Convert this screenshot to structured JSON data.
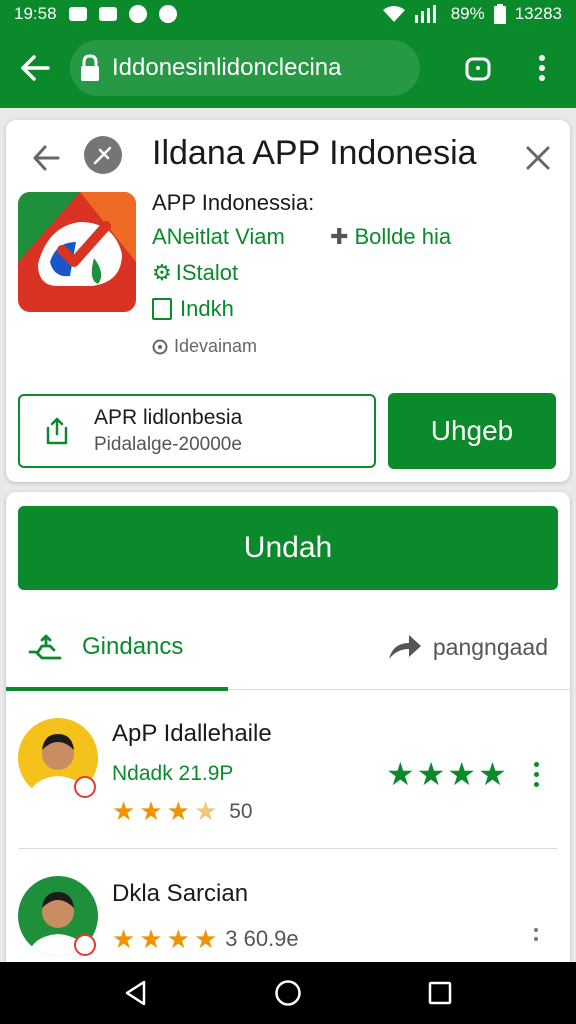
{
  "status_bar": {
    "time": "19:58",
    "battery": "89%",
    "right_time": "13283",
    "icons": [
      "mail-icon",
      "image-icon",
      "location-icon",
      "smiley-icon",
      "wifi-icon",
      "signal-icon",
      "battery-icon"
    ]
  },
  "browser": {
    "url": "Iddonesinlidonclecina",
    "icons": [
      "back-arrow-icon",
      "lock-icon",
      "tab-switcher-icon",
      "overflow-menu-icon"
    ]
  },
  "app_header": {
    "title": "Ildana APP Indonesia",
    "app_name": "APP Indonessia:",
    "developer": "ANeitlat Viam",
    "bundle": "Bollde hia",
    "installed": "IStalot",
    "index": "Indkh",
    "dev_info": "Idevainam",
    "package_name": "APR lidlonbesia",
    "package_sub": "Pidalalge-20000e",
    "update_label": "Uhgeb"
  },
  "main": {
    "install_label": "Undah",
    "tab_active": "Gindancs",
    "tab_other": "pangngaad"
  },
  "reviews": [
    {
      "name": "ApP Idallehaile",
      "subtitle": "Ndadk 21.9P",
      "rating_value": "50",
      "stars_filled": 3,
      "stars_half": 1,
      "green_stars": 4
    },
    {
      "name": "Dkla Sarcian",
      "rating_value": "3 60.9e",
      "stars_filled": 4
    }
  ],
  "colors": {
    "primary_green": "#0a8a2a",
    "star_orange": "#f09300",
    "background": "#e9e9e9"
  },
  "nav": {
    "icons": [
      "nav-back-icon",
      "nav-home-icon",
      "nav-recents-icon"
    ]
  }
}
